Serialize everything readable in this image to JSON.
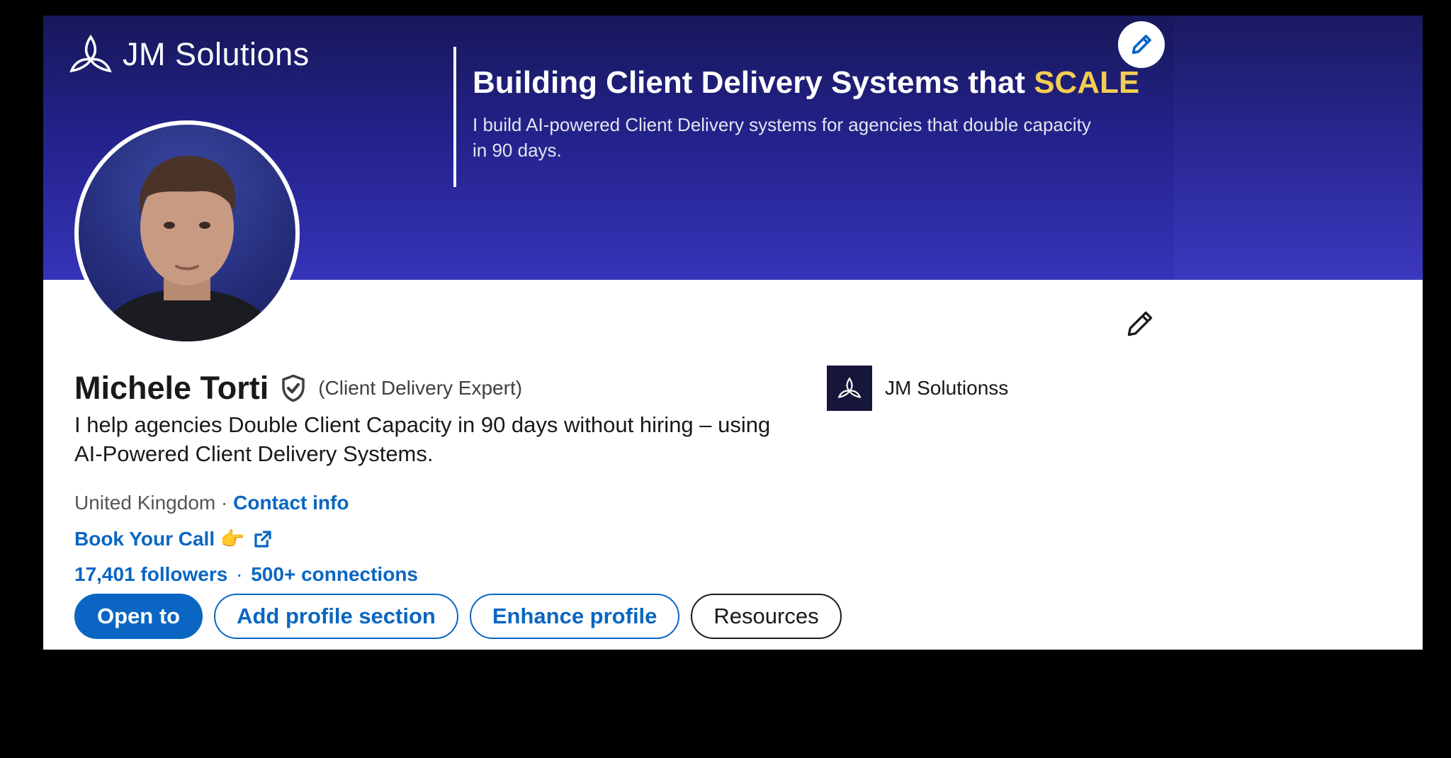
{
  "banner": {
    "brand_name": "JM Solutions",
    "headline_main": "Building Client Delivery Systems that ",
    "headline_accent": "SCALE",
    "subheadline": "I build AI-powered Client Delivery systems for agencies that double capacity in 90 days.",
    "accent_color": "#f3cd53",
    "edit_icon": "pencil-icon"
  },
  "profile": {
    "name": "Michele Torti",
    "verified_icon": "shield-check-icon",
    "pronoun": "(Client Delivery Expert)",
    "headline": "I help agencies Double Client Capacity in 90 days without hiring – using AI-Powered Client Delivery Systems.",
    "location": "United Kingdom",
    "location_separator": " · ",
    "contact_info_label": "Contact info",
    "book_call_label": "Book Your Call 👉",
    "external_link_icon": "external-link-icon",
    "followers_label": "17,401 followers",
    "stats_separator": "·",
    "connections_label": "500+ connections"
  },
  "actions": {
    "open_to": "Open to",
    "add_section": "Add profile section",
    "enhance": "Enhance profile",
    "resources": "Resources"
  },
  "company": {
    "name": "JM Solutionss",
    "logo_icon": "jm-logo-icon"
  },
  "colors": {
    "link_blue": "#0a66c2",
    "banner_dark": "#17185a",
    "banner_light": "#3633b8"
  }
}
